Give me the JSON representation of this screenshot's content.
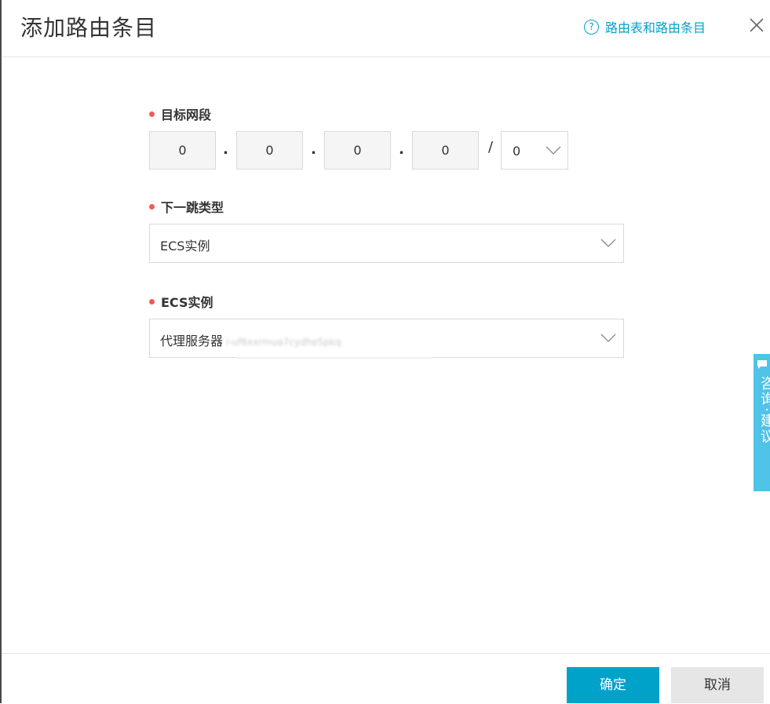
{
  "dialog": {
    "title": "添加路由条目",
    "help_link": "路由表和路由条目",
    "help_icon": "?"
  },
  "destination": {
    "label": "目标网段",
    "octets": [
      "0",
      "0",
      "0",
      "0"
    ],
    "separator": ".",
    "slash": "/",
    "mask": "0"
  },
  "next_hop_type": {
    "label": "下一跳类型",
    "value": "ECS实例"
  },
  "ecs_instance": {
    "label": "ECS实例",
    "value": "代理服务器",
    "value_suffix_blurred": "i-uf6xxrmua7cydhe5pkq"
  },
  "feedback": {
    "label": "咨询·建议"
  },
  "buttons": {
    "confirm": "确定",
    "cancel": "取消"
  },
  "colors": {
    "accent": "#00a2ca",
    "required": "#f05a5a",
    "feedback": "#4fc3e8"
  }
}
